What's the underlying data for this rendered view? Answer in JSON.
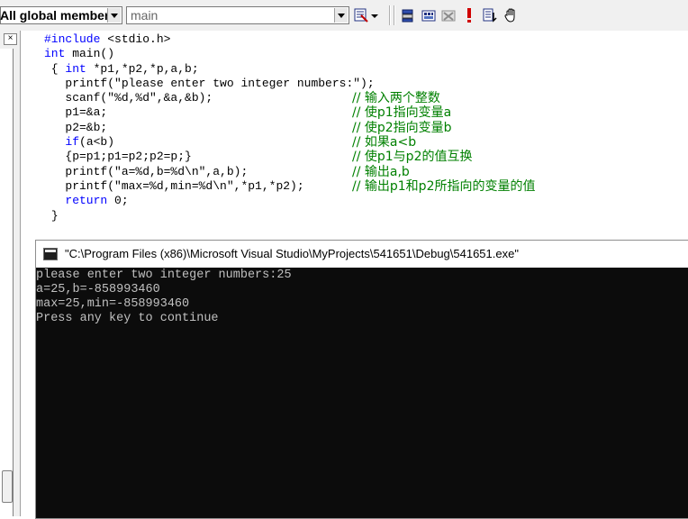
{
  "toolbar": {
    "scope_value": "All global members",
    "member_placeholder": "main",
    "buttons": [
      "wizard-bar-actions-icon",
      "compile-icon",
      "build-icon",
      "stop-build-icon",
      "execute-icon",
      "go-icon",
      "insert-breakpoint-icon"
    ]
  },
  "editor": {
    "lines": [
      {
        "code": "#include <stdio.h>",
        "kw": "#include",
        "rest": " <stdio.h>",
        "comment": ""
      },
      {
        "kw": "int",
        "rest": " main()",
        "comment": ""
      },
      {
        "pre": " { ",
        "kw": "int",
        "rest": " *p1,*p2,*p,a,b;",
        "comment": ""
      },
      {
        "pre": "   ",
        "rest": "printf(\"please enter two integer numbers:\");",
        "comment": ""
      },
      {
        "pre": "   ",
        "rest": "scanf(\"%d,%d\",&a,&b);",
        "comment": "// 输入两个整数"
      },
      {
        "pre": "   ",
        "rest": "p1=&a;",
        "comment": "// 使p1指向变量a"
      },
      {
        "pre": "   ",
        "rest": "p2=&b;",
        "comment": "// 使p2指向变量b"
      },
      {
        "pre": "   ",
        "kw": "if",
        "rest": "(a<b)",
        "comment": "// 如果a<b"
      },
      {
        "pre": "   ",
        "rest": "{p=p1;p1=p2;p2=p;}",
        "comment": "// 使p1与p2的值互换"
      },
      {
        "pre": "   ",
        "rest": "printf(\"a=%d,b=%d\\n\",a,b);",
        "comment": "// 输出a,b"
      },
      {
        "pre": "   ",
        "rest": "printf(\"max=%d,min=%d\\n\",*p1,*p2);",
        "comment": "// 输出p1和p2所指向的变量的值"
      },
      {
        "pre": "   ",
        "kw": "return",
        "rest": " 0;",
        "comment": ""
      },
      {
        "pre": " ",
        "rest": "}",
        "comment": ""
      }
    ]
  },
  "console": {
    "title": "\"C:\\Program Files (x86)\\Microsoft Visual Studio\\MyProjects\\541651\\Debug\\541651.exe\"",
    "output": [
      "please enter two integer numbers:25",
      "a=25,b=-858993460",
      "max=25,min=-858993460",
      "Press any key to continue"
    ]
  }
}
